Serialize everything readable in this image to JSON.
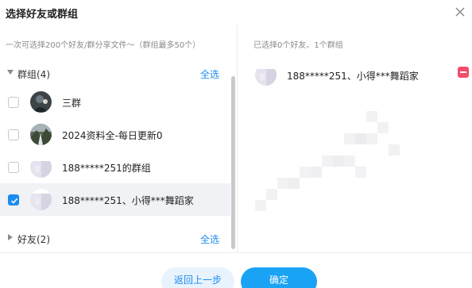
{
  "dialog": {
    "title": "选择好友或群组",
    "close_icon": "close-icon"
  },
  "left": {
    "hint": "一次可选择200个好友/群分享文件～（群组最多50个）",
    "groups_section": {
      "label": "群组(4)",
      "select_all": "全选",
      "expanded": true
    },
    "groups": [
      {
        "name": "三群",
        "checked": false
      },
      {
        "name": "2024资料全-每日更新0",
        "checked": false
      },
      {
        "name": "188*****251的群组",
        "checked": false
      },
      {
        "name": "188*****251、小得***舞蹈家",
        "checked": true
      }
    ],
    "friends_section": {
      "label": "好友(2)",
      "select_all": "全选",
      "expanded": false
    }
  },
  "right": {
    "selected_count": "已选择0个好友、1个群组",
    "selected_items": [
      {
        "name": "188*****251、小得***舞蹈家",
        "remove_icon": "minus-icon"
      }
    ]
  },
  "footer": {
    "back_label": "返回上一步",
    "confirm_label": "确定"
  },
  "colors": {
    "accent": "#1a8cf0",
    "confirm_bg": "#1aa3f5",
    "remove": "#f44c6a",
    "selected_row": "#f0f2f5"
  }
}
